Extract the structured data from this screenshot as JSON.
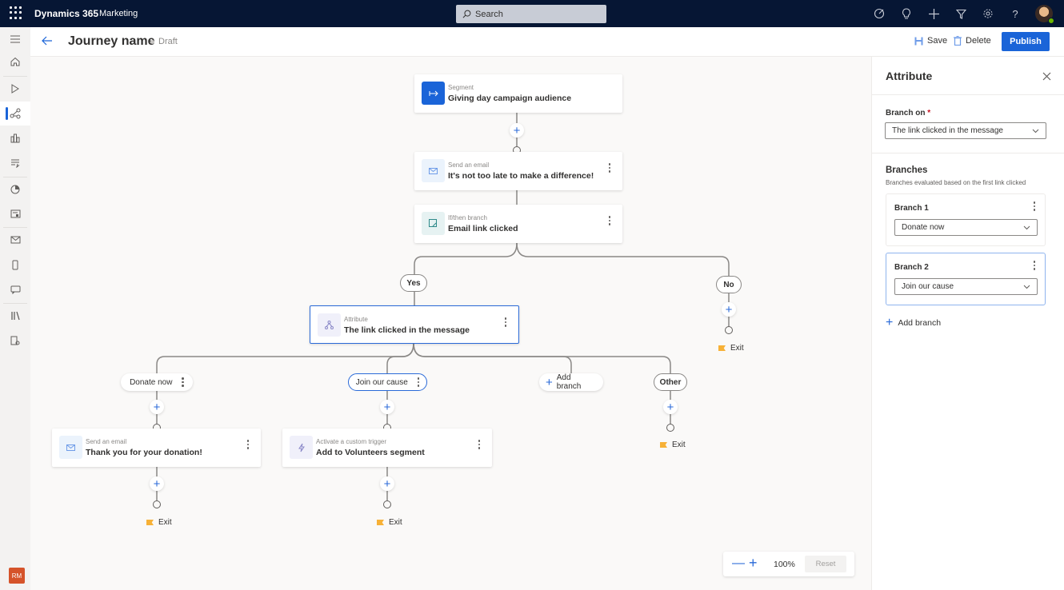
{
  "app": {
    "name": "Dynamics 365",
    "area": "Marketing",
    "search_placeholder": "Search",
    "header_icons": [
      "assistant-icon",
      "lightbulb-icon",
      "add-icon",
      "filter-icon",
      "settings-icon",
      "help-icon",
      "user-avatar"
    ]
  },
  "left_nav": {
    "items": [
      {
        "name": "hamburger-menu",
        "icon": "menu-icon"
      },
      {
        "name": "home",
        "icon": "home-icon"
      },
      {
        "name": "recent",
        "icon": "play-icon"
      },
      {
        "name": "journeys",
        "icon": "journey-icon",
        "active": true
      },
      {
        "name": "segments",
        "icon": "segments-icon"
      },
      {
        "name": "triggers",
        "icon": "triggers-icon"
      },
      {
        "name": "analytics",
        "icon": "analytics-icon"
      },
      {
        "name": "forms",
        "icon": "forms-icon"
      },
      {
        "name": "emails",
        "icon": "email-icon"
      },
      {
        "name": "push",
        "icon": "mobile-icon"
      },
      {
        "name": "text",
        "icon": "chat-icon"
      },
      {
        "name": "library",
        "icon": "library-icon"
      },
      {
        "name": "assets",
        "icon": "assets-icon"
      }
    ],
    "user_initials": "RM"
  },
  "command_bar": {
    "title": "Journey name",
    "status": "Draft",
    "save_label": "Save",
    "delete_label": "Delete",
    "publish_label": "Publish"
  },
  "journey": {
    "segment": {
      "category": "Segment",
      "name": "Giving day campaign audience"
    },
    "email1": {
      "category": "Send an email",
      "name": "It's not too late to make a difference!"
    },
    "ifthen": {
      "category": "If/then branch",
      "name": "Email link clicked"
    },
    "yes_label": "Yes",
    "no_label": "No",
    "attribute": {
      "category": "Attribute",
      "name": "The link clicked in the message"
    },
    "branch_donate": "Donate now",
    "branch_join": "Join our cause",
    "add_branch_label": "Add branch",
    "branch_other": "Other",
    "email2": {
      "category": "Send an email",
      "name": "Thank you for your donation!"
    },
    "trigger": {
      "category": "Activate a custom trigger",
      "name": "Add to Volunteers segment"
    },
    "exit_label": "Exit"
  },
  "zoom_controls": {
    "zoom_value": "100%",
    "reset_label": "Reset"
  },
  "panel": {
    "title": "Attribute",
    "branch_on_label": "Branch on",
    "branch_on_value": "The link clicked in the message",
    "branches_title": "Branches",
    "branches_subtitle": "Branches evaluated based on the first link clicked",
    "branches": [
      {
        "name": "Branch 1",
        "value": "Donate now"
      },
      {
        "name": "Branch 2",
        "value": "Join our cause"
      }
    ],
    "add_branch_label": "Add branch"
  },
  "colors": {
    "topbar": "#061634",
    "accent": "#1a64d8",
    "exit_flag": "#f7b137",
    "user_badge": "#d5532a"
  }
}
